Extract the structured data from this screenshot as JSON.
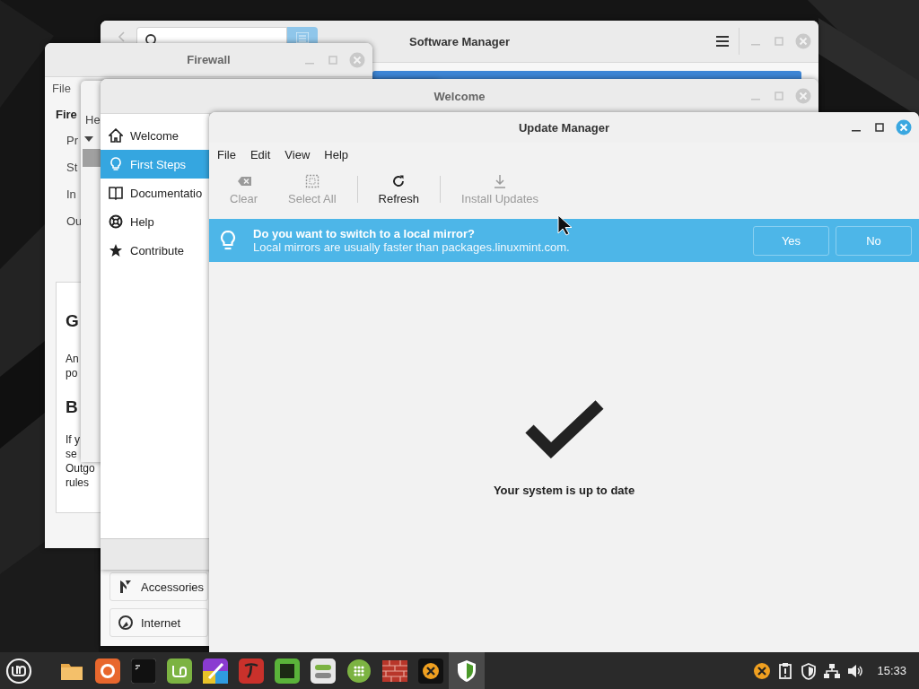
{
  "software_manager": {
    "title": "Software Manager",
    "categories": [
      {
        "kind": "accessories",
        "label": "Accessories"
      },
      {
        "kind": "internet",
        "label": "Internet"
      }
    ]
  },
  "firewall": {
    "title": "Firewall",
    "menu": [
      "File"
    ],
    "heading": "Fire",
    "rows": [
      "Pr",
      "St",
      "In",
      "Ou"
    ],
    "card": {
      "title": "G",
      "paragraph_1": [
        "An",
        "po"
      ],
      "subtitle": "B",
      "paragraph_2": [
        "If y",
        "se",
        "Outgo",
        "rules"
      ]
    }
  },
  "help_window": {
    "menu": [
      "He"
    ]
  },
  "welcome": {
    "title": "Welcome",
    "sidebar": [
      {
        "kind": "home",
        "label": "Welcome",
        "selected": false
      },
      {
        "kind": "bulb",
        "label": "First Steps",
        "selected": true
      },
      {
        "kind": "book",
        "label": "Documentatio",
        "selected": false
      },
      {
        "kind": "help",
        "label": "Help",
        "selected": false
      },
      {
        "kind": "star",
        "label": "Contribute",
        "selected": false
      }
    ]
  },
  "update_manager": {
    "title": "Update Manager",
    "menu": [
      "File",
      "Edit",
      "View",
      "Help"
    ],
    "toolbar": [
      {
        "kind": "clear",
        "label": "Clear",
        "disabled": true
      },
      {
        "kind": "select_all",
        "label": "Select All",
        "disabled": true
      },
      {
        "kind": "separator"
      },
      {
        "kind": "refresh",
        "label": "Refresh",
        "disabled": false
      },
      {
        "kind": "separator"
      },
      {
        "kind": "install",
        "label": "Install Updates",
        "disabled": true
      }
    ],
    "infobar": {
      "title": "Do you want to switch to a local mirror?",
      "message": "Local mirrors are usually faster than packages.linuxmint.com.",
      "buttons": [
        "Yes",
        "No"
      ]
    },
    "status": "Your system is up to date"
  },
  "taskbar": {
    "apps": [
      {
        "kind": "folder",
        "selected": false
      },
      {
        "kind": "browser",
        "selected": false
      },
      {
        "kind": "terminal",
        "selected": false
      },
      {
        "kind": "mint",
        "selected": false
      },
      {
        "kind": "paint",
        "selected": false
      },
      {
        "kind": "font",
        "selected": false
      },
      {
        "kind": "screen",
        "selected": false
      },
      {
        "kind": "toggles",
        "selected": false
      },
      {
        "kind": "grid",
        "selected": false
      },
      {
        "kind": "bricks",
        "selected": false
      },
      {
        "kind": "cross",
        "selected": false
      },
      {
        "kind": "shield",
        "selected": true
      }
    ],
    "tray": [
      {
        "kind": "cross"
      },
      {
        "kind": "notes"
      },
      {
        "kind": "shield"
      },
      {
        "kind": "network"
      },
      {
        "kind": "volume"
      }
    ],
    "clock": "15:33"
  }
}
